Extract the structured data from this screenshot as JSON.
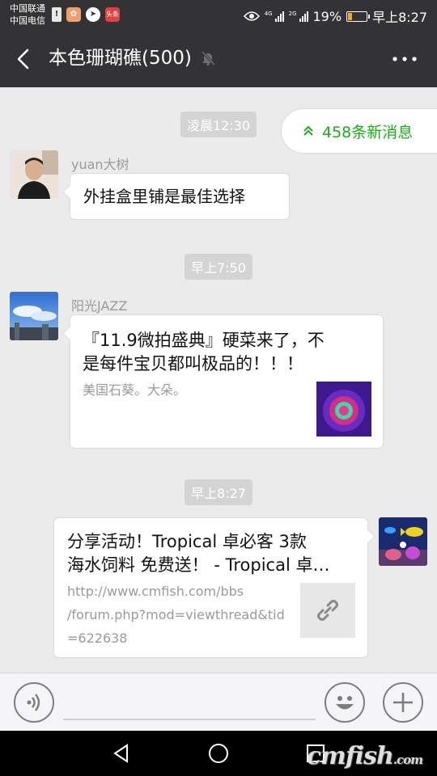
{
  "status_bar": {
    "carrier1": "中国联通",
    "carrier2": "中国电信",
    "app_badge": "头条",
    "net_4g": "4G",
    "net_2g": "2G",
    "battery": "19%",
    "time": "早上8:27",
    "battery_level": 0.19
  },
  "header": {
    "title": "本色珊瑚礁(500)",
    "muted": true
  },
  "new_messages": "458条新消息",
  "timestamps": [
    "凌晨12:30",
    "早上7:50",
    "早上8:27"
  ],
  "messages": [
    {
      "sender": "yuan大树",
      "text": "外挂盒里铺是最佳选择"
    },
    {
      "sender": "阳光JAZZ",
      "card_title_line1": "『11.9微拍盛典』硬菜来了，不",
      "card_title_line2": "是每件宝贝都叫极品的！！！",
      "card_desc": "美国石葵。大朵。"
    },
    {
      "card_title_line1": "分享活动！Tropical 卓必客 3款",
      "card_title_line2": "海水饲料 免费送！ - Tropical 卓…",
      "url_line1": "http://www.cmfish.com/bbs",
      "url_line2": "/forum.php?mod=viewthread&tid",
      "url_line3": "=622638"
    }
  ],
  "watermark": {
    "main": "cmfish",
    "suffix": ".com"
  },
  "colors": {
    "accent_green": "#1aad19",
    "header_bg": "#333335",
    "chat_bg": "#ebebeb"
  }
}
